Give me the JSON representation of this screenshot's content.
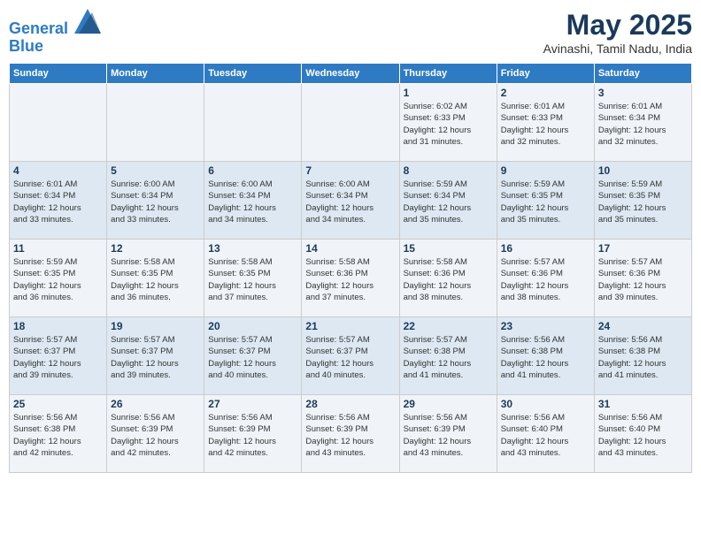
{
  "header": {
    "logo_line1": "General",
    "logo_line2": "Blue",
    "title": "May 2025",
    "subtitle": "Avinashi, Tamil Nadu, India"
  },
  "days_of_week": [
    "Sunday",
    "Monday",
    "Tuesday",
    "Wednesday",
    "Thursday",
    "Friday",
    "Saturday"
  ],
  "weeks": [
    [
      {
        "day": "",
        "info": ""
      },
      {
        "day": "",
        "info": ""
      },
      {
        "day": "",
        "info": ""
      },
      {
        "day": "",
        "info": ""
      },
      {
        "day": "1",
        "info": "Sunrise: 6:02 AM\nSunset: 6:33 PM\nDaylight: 12 hours\nand 31 minutes."
      },
      {
        "day": "2",
        "info": "Sunrise: 6:01 AM\nSunset: 6:33 PM\nDaylight: 12 hours\nand 32 minutes."
      },
      {
        "day": "3",
        "info": "Sunrise: 6:01 AM\nSunset: 6:34 PM\nDaylight: 12 hours\nand 32 minutes."
      }
    ],
    [
      {
        "day": "4",
        "info": "Sunrise: 6:01 AM\nSunset: 6:34 PM\nDaylight: 12 hours\nand 33 minutes."
      },
      {
        "day": "5",
        "info": "Sunrise: 6:00 AM\nSunset: 6:34 PM\nDaylight: 12 hours\nand 33 minutes."
      },
      {
        "day": "6",
        "info": "Sunrise: 6:00 AM\nSunset: 6:34 PM\nDaylight: 12 hours\nand 34 minutes."
      },
      {
        "day": "7",
        "info": "Sunrise: 6:00 AM\nSunset: 6:34 PM\nDaylight: 12 hours\nand 34 minutes."
      },
      {
        "day": "8",
        "info": "Sunrise: 5:59 AM\nSunset: 6:34 PM\nDaylight: 12 hours\nand 35 minutes."
      },
      {
        "day": "9",
        "info": "Sunrise: 5:59 AM\nSunset: 6:35 PM\nDaylight: 12 hours\nand 35 minutes."
      },
      {
        "day": "10",
        "info": "Sunrise: 5:59 AM\nSunset: 6:35 PM\nDaylight: 12 hours\nand 35 minutes."
      }
    ],
    [
      {
        "day": "11",
        "info": "Sunrise: 5:59 AM\nSunset: 6:35 PM\nDaylight: 12 hours\nand 36 minutes."
      },
      {
        "day": "12",
        "info": "Sunrise: 5:58 AM\nSunset: 6:35 PM\nDaylight: 12 hours\nand 36 minutes."
      },
      {
        "day": "13",
        "info": "Sunrise: 5:58 AM\nSunset: 6:35 PM\nDaylight: 12 hours\nand 37 minutes."
      },
      {
        "day": "14",
        "info": "Sunrise: 5:58 AM\nSunset: 6:36 PM\nDaylight: 12 hours\nand 37 minutes."
      },
      {
        "day": "15",
        "info": "Sunrise: 5:58 AM\nSunset: 6:36 PM\nDaylight: 12 hours\nand 38 minutes."
      },
      {
        "day": "16",
        "info": "Sunrise: 5:57 AM\nSunset: 6:36 PM\nDaylight: 12 hours\nand 38 minutes."
      },
      {
        "day": "17",
        "info": "Sunrise: 5:57 AM\nSunset: 6:36 PM\nDaylight: 12 hours\nand 39 minutes."
      }
    ],
    [
      {
        "day": "18",
        "info": "Sunrise: 5:57 AM\nSunset: 6:37 PM\nDaylight: 12 hours\nand 39 minutes."
      },
      {
        "day": "19",
        "info": "Sunrise: 5:57 AM\nSunset: 6:37 PM\nDaylight: 12 hours\nand 39 minutes."
      },
      {
        "day": "20",
        "info": "Sunrise: 5:57 AM\nSunset: 6:37 PM\nDaylight: 12 hours\nand 40 minutes."
      },
      {
        "day": "21",
        "info": "Sunrise: 5:57 AM\nSunset: 6:37 PM\nDaylight: 12 hours\nand 40 minutes."
      },
      {
        "day": "22",
        "info": "Sunrise: 5:57 AM\nSunset: 6:38 PM\nDaylight: 12 hours\nand 41 minutes."
      },
      {
        "day": "23",
        "info": "Sunrise: 5:56 AM\nSunset: 6:38 PM\nDaylight: 12 hours\nand 41 minutes."
      },
      {
        "day": "24",
        "info": "Sunrise: 5:56 AM\nSunset: 6:38 PM\nDaylight: 12 hours\nand 41 minutes."
      }
    ],
    [
      {
        "day": "25",
        "info": "Sunrise: 5:56 AM\nSunset: 6:38 PM\nDaylight: 12 hours\nand 42 minutes."
      },
      {
        "day": "26",
        "info": "Sunrise: 5:56 AM\nSunset: 6:39 PM\nDaylight: 12 hours\nand 42 minutes."
      },
      {
        "day": "27",
        "info": "Sunrise: 5:56 AM\nSunset: 6:39 PM\nDaylight: 12 hours\nand 42 minutes."
      },
      {
        "day": "28",
        "info": "Sunrise: 5:56 AM\nSunset: 6:39 PM\nDaylight: 12 hours\nand 43 minutes."
      },
      {
        "day": "29",
        "info": "Sunrise: 5:56 AM\nSunset: 6:39 PM\nDaylight: 12 hours\nand 43 minutes."
      },
      {
        "day": "30",
        "info": "Sunrise: 5:56 AM\nSunset: 6:40 PM\nDaylight: 12 hours\nand 43 minutes."
      },
      {
        "day": "31",
        "info": "Sunrise: 5:56 AM\nSunset: 6:40 PM\nDaylight: 12 hours\nand 43 minutes."
      }
    ]
  ]
}
